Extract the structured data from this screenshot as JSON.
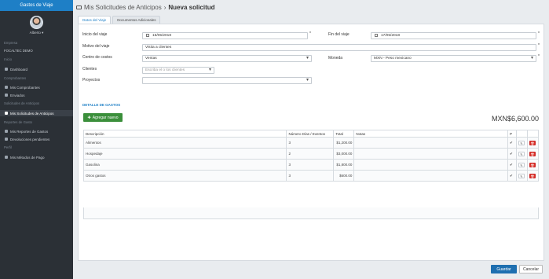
{
  "sidebar": {
    "header": "Gastos de Viaje",
    "user": "Alberto ▾",
    "sections": [
      {
        "label": "Empresa"
      },
      {
        "label": "Inicio"
      },
      {
        "label": "Comprobantes"
      },
      {
        "label": "Solicitudes de Anticipos"
      },
      {
        "label": "Reportes de Gasto"
      },
      {
        "label": "Perfil"
      }
    ],
    "company": "FOCALTEC DEMO",
    "items": [
      {
        "label": "Dashboard"
      },
      {
        "label": "Mis Comprobantes"
      },
      {
        "label": "Enviados"
      },
      {
        "label": "Mis Solicitudes de Anticipos"
      },
      {
        "label": "Mis Reportes de Gastos"
      },
      {
        "label": "Devoluciones pendientes"
      },
      {
        "label": "Mis Métodos de Pago"
      }
    ]
  },
  "header": {
    "title": "Mis Solicitudes de Anticipos",
    "separator": "›",
    "subtitle": "Nueva solicitud"
  },
  "tabs": [
    {
      "label": "Datos del Viaje"
    },
    {
      "label": "Documentos Adicionales"
    }
  ],
  "form": {
    "inicio_label": "Inicio del viaje",
    "inicio_value": "15/05/2018",
    "fin_label": "Fin del viaje",
    "fin_value": "17/05/2018",
    "motivo_label": "Motivo del viaje",
    "motivo_value": "Visita a clientes",
    "centro_label": "Centro de costos",
    "centro_value": "Ventas",
    "moneda_label": "Moneda",
    "moneda_value": "MXN - Peso mexicano",
    "clientes_label": "Clientes",
    "clientes_placeholder": "Escriba el o los clientes",
    "proyectos_label": "Proyectos",
    "proyectos_value": "",
    "required_mark": "*"
  },
  "gastos": {
    "section_title": "DETALLE DE GASTOS",
    "add_button": "Agregar nuevo",
    "total": "MXN$6,600.00",
    "columns": [
      "Descripción",
      "Número Días / Eventos",
      "Total",
      "Notas",
      "P"
    ],
    "rows": [
      {
        "desc": "Alimentos",
        "dias": "3",
        "total": "$1,200.00",
        "notas": "",
        "check": "✔"
      },
      {
        "desc": "Hospedaje",
        "dias": "2",
        "total": "$3,000.00",
        "notas": "",
        "check": "✔"
      },
      {
        "desc": "Gasolina",
        "dias": "3",
        "total": "$1,800.00",
        "notas": "",
        "check": "✔"
      },
      {
        "desc": "Otros gastos",
        "dias": "3",
        "total": "$600.00",
        "notas": "",
        "check": "✔"
      }
    ]
  },
  "footer": {
    "save": "Guardar",
    "cancel": "Cancelar"
  }
}
